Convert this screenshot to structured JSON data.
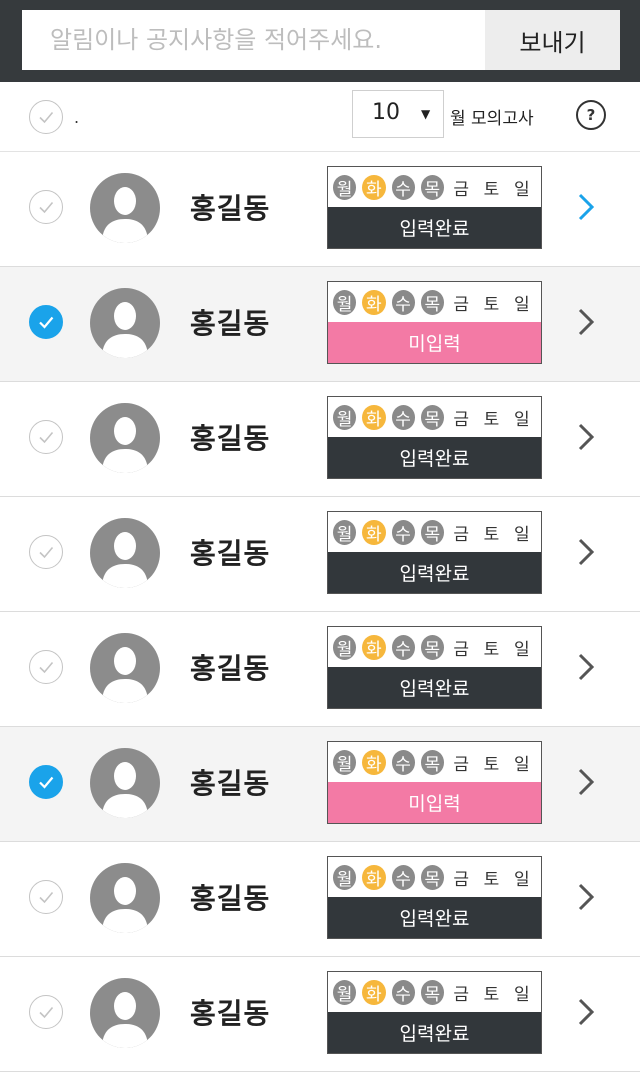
{
  "topbar": {
    "placeholder": "알림이나 공지사항을 적어주세요.",
    "send_label": "보내기"
  },
  "header": {
    "select_all_label": ".",
    "month_value": "10",
    "month_suffix": "월 모의고사",
    "help_label": "?"
  },
  "colors": {
    "accent": "#1aa3ea",
    "today": "#f6b73c",
    "done": "#8a8a8a",
    "complete_bar": "#32373b",
    "pending_bar": "#f37aa5"
  },
  "students": [
    {
      "name": "홍길동",
      "checked": false,
      "status": "입력완료",
      "status_type": "complete",
      "chevron": "active",
      "days": [
        {
          "label": "월",
          "state": "done"
        },
        {
          "label": "화",
          "state": "today"
        },
        {
          "label": "수",
          "state": "done"
        },
        {
          "label": "목",
          "state": "done"
        },
        {
          "label": "금",
          "state": "plain"
        },
        {
          "label": "토",
          "state": "plain"
        },
        {
          "label": "일",
          "state": "plain"
        }
      ]
    },
    {
      "name": "홍길동",
      "checked": true,
      "status": "미입력",
      "status_type": "pending",
      "chevron": "normal",
      "days": [
        {
          "label": "월",
          "state": "done"
        },
        {
          "label": "화",
          "state": "today"
        },
        {
          "label": "수",
          "state": "done"
        },
        {
          "label": "목",
          "state": "done"
        },
        {
          "label": "금",
          "state": "plain"
        },
        {
          "label": "토",
          "state": "plain"
        },
        {
          "label": "일",
          "state": "plain"
        }
      ]
    },
    {
      "name": "홍길동",
      "checked": false,
      "status": "입력완료",
      "status_type": "complete",
      "chevron": "normal",
      "days": [
        {
          "label": "월",
          "state": "done"
        },
        {
          "label": "화",
          "state": "today"
        },
        {
          "label": "수",
          "state": "done"
        },
        {
          "label": "목",
          "state": "done"
        },
        {
          "label": "금",
          "state": "plain"
        },
        {
          "label": "토",
          "state": "plain"
        },
        {
          "label": "일",
          "state": "plain"
        }
      ]
    },
    {
      "name": "홍길동",
      "checked": false,
      "status": "입력완료",
      "status_type": "complete",
      "chevron": "normal",
      "days": [
        {
          "label": "월",
          "state": "done"
        },
        {
          "label": "화",
          "state": "today"
        },
        {
          "label": "수",
          "state": "done"
        },
        {
          "label": "목",
          "state": "done"
        },
        {
          "label": "금",
          "state": "plain"
        },
        {
          "label": "토",
          "state": "plain"
        },
        {
          "label": "일",
          "state": "plain"
        }
      ]
    },
    {
      "name": "홍길동",
      "checked": false,
      "status": "입력완료",
      "status_type": "complete",
      "chevron": "normal",
      "days": [
        {
          "label": "월",
          "state": "done"
        },
        {
          "label": "화",
          "state": "today"
        },
        {
          "label": "수",
          "state": "done"
        },
        {
          "label": "목",
          "state": "done"
        },
        {
          "label": "금",
          "state": "plain"
        },
        {
          "label": "토",
          "state": "plain"
        },
        {
          "label": "일",
          "state": "plain"
        }
      ]
    },
    {
      "name": "홍길동",
      "checked": true,
      "status": "미입력",
      "status_type": "pending",
      "chevron": "normal",
      "days": [
        {
          "label": "월",
          "state": "done"
        },
        {
          "label": "화",
          "state": "today"
        },
        {
          "label": "수",
          "state": "done"
        },
        {
          "label": "목",
          "state": "done"
        },
        {
          "label": "금",
          "state": "plain"
        },
        {
          "label": "토",
          "state": "plain"
        },
        {
          "label": "일",
          "state": "plain"
        }
      ]
    },
    {
      "name": "홍길동",
      "checked": false,
      "status": "입력완료",
      "status_type": "complete",
      "chevron": "normal",
      "days": [
        {
          "label": "월",
          "state": "done"
        },
        {
          "label": "화",
          "state": "today"
        },
        {
          "label": "수",
          "state": "done"
        },
        {
          "label": "목",
          "state": "done"
        },
        {
          "label": "금",
          "state": "plain"
        },
        {
          "label": "토",
          "state": "plain"
        },
        {
          "label": "일",
          "state": "plain"
        }
      ]
    },
    {
      "name": "홍길동",
      "checked": false,
      "status": "입력완료",
      "status_type": "complete",
      "chevron": "normal",
      "days": [
        {
          "label": "월",
          "state": "done"
        },
        {
          "label": "화",
          "state": "today"
        },
        {
          "label": "수",
          "state": "done"
        },
        {
          "label": "목",
          "state": "done"
        },
        {
          "label": "금",
          "state": "plain"
        },
        {
          "label": "토",
          "state": "plain"
        },
        {
          "label": "일",
          "state": "plain"
        }
      ]
    }
  ]
}
